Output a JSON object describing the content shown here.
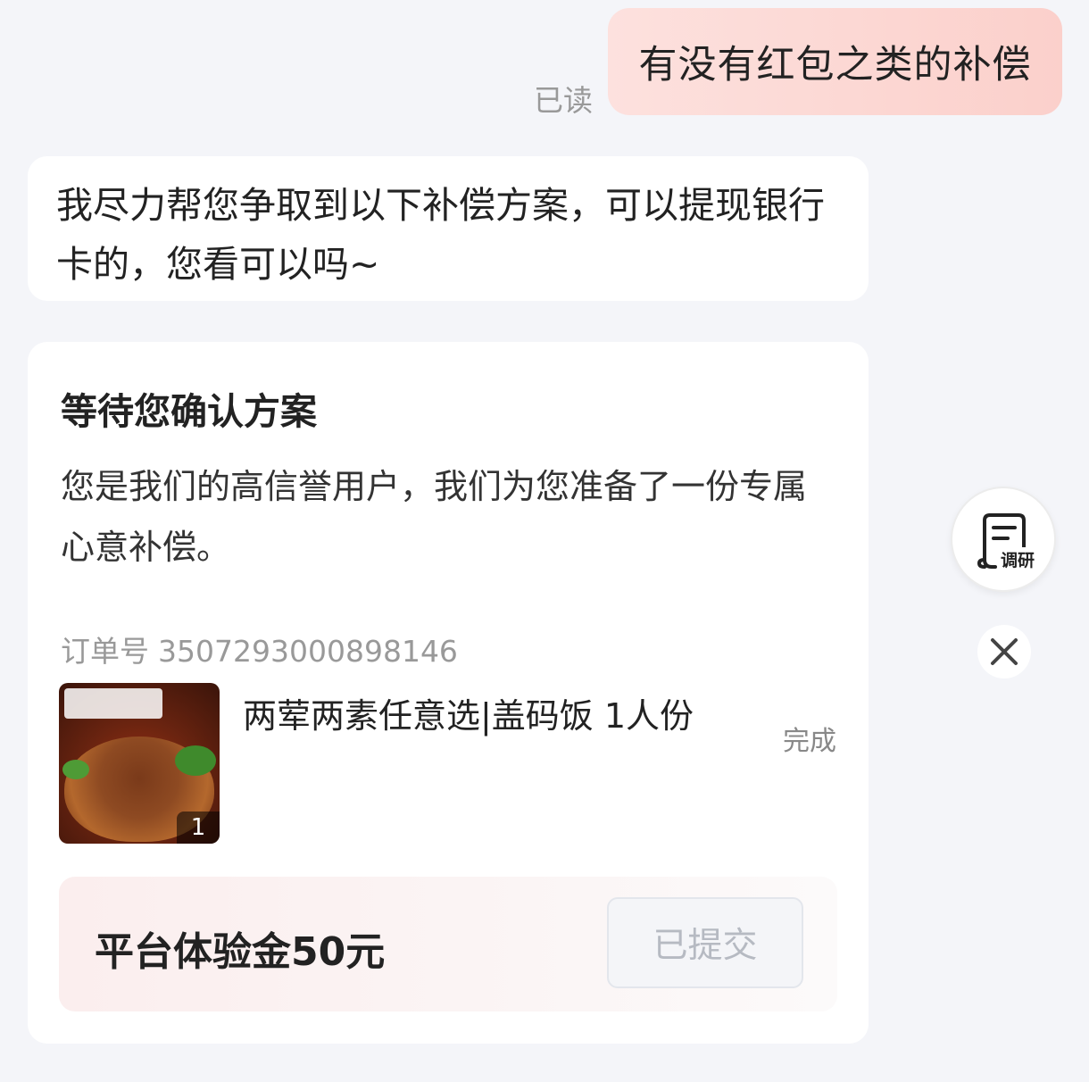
{
  "user_message": {
    "text": "有没有红包之类的补偿",
    "read_label": "已读"
  },
  "agent_message": {
    "text": "我尽力帮您争取到以下补偿方案，可以提现银行卡的，您看可以吗~"
  },
  "card": {
    "title": "等待您确认方案",
    "description": "您是我们的高信誉用户，我们为您准备了一份专属心意补偿。",
    "order_label": "订单号",
    "order_number": "3507293000898146",
    "product": {
      "name": "两荤两素任意选|盖码饭 1人份",
      "quantity": "1",
      "status": "完成"
    },
    "compensation": {
      "label": "平台体验金50元",
      "button_label": "已提交"
    }
  },
  "floating": {
    "survey_label": "调研"
  },
  "colors": {
    "background": "#f4f5f9",
    "user_bubble": "#fbd0cb",
    "button_disabled_text": "#b6bac2"
  }
}
